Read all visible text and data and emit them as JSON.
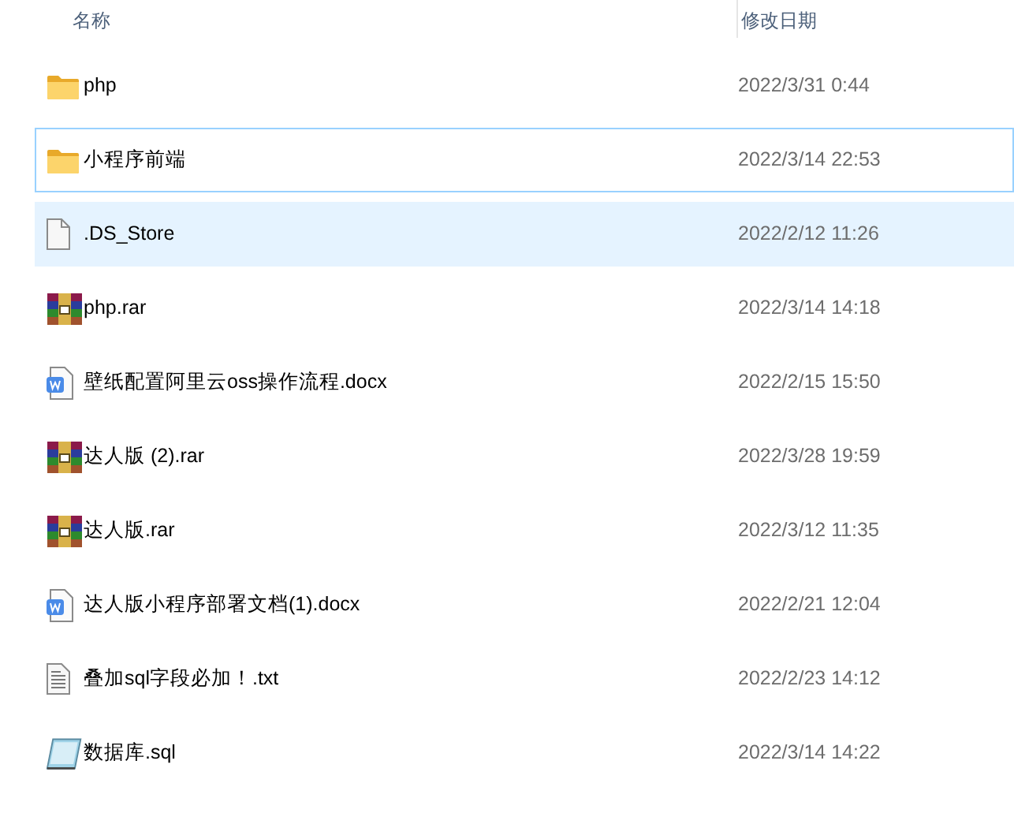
{
  "columns": [
    "名称",
    "修改日期"
  ],
  "files": [
    {
      "kind": "folder",
      "name": "php",
      "date": "2022/3/31 0:44",
      "selected": false,
      "focused": false
    },
    {
      "kind": "folder",
      "name": "小程序前端",
      "date": "2022/3/14 22:53",
      "selected": false,
      "focused": true
    },
    {
      "kind": "file",
      "name": ".DS_Store",
      "date": "2022/2/12 11:26",
      "selected": true,
      "focused": false
    },
    {
      "kind": "rar",
      "name": "php.rar",
      "date": "2022/3/14 14:18",
      "selected": false,
      "focused": false
    },
    {
      "kind": "docx",
      "name": "壁纸配置阿里云oss操作流程.docx",
      "date": "2022/2/15 15:50",
      "selected": false,
      "focused": false
    },
    {
      "kind": "rar",
      "name": "达人版 (2).rar",
      "date": "2022/3/28 19:59",
      "selected": false,
      "focused": false
    },
    {
      "kind": "rar",
      "name": "达人版.rar",
      "date": "2022/3/12 11:35",
      "selected": false,
      "focused": false
    },
    {
      "kind": "docx",
      "name": "达人版小程序部署文档(1).docx",
      "date": "2022/2/21 12:04",
      "selected": false,
      "focused": false
    },
    {
      "kind": "txt",
      "name": "叠加sql字段必加！.txt",
      "date": "2022/2/23 14:12",
      "selected": false,
      "focused": false
    },
    {
      "kind": "sql",
      "name": "数据库.sql",
      "date": "2022/3/14 14:22",
      "selected": false,
      "focused": false
    }
  ]
}
